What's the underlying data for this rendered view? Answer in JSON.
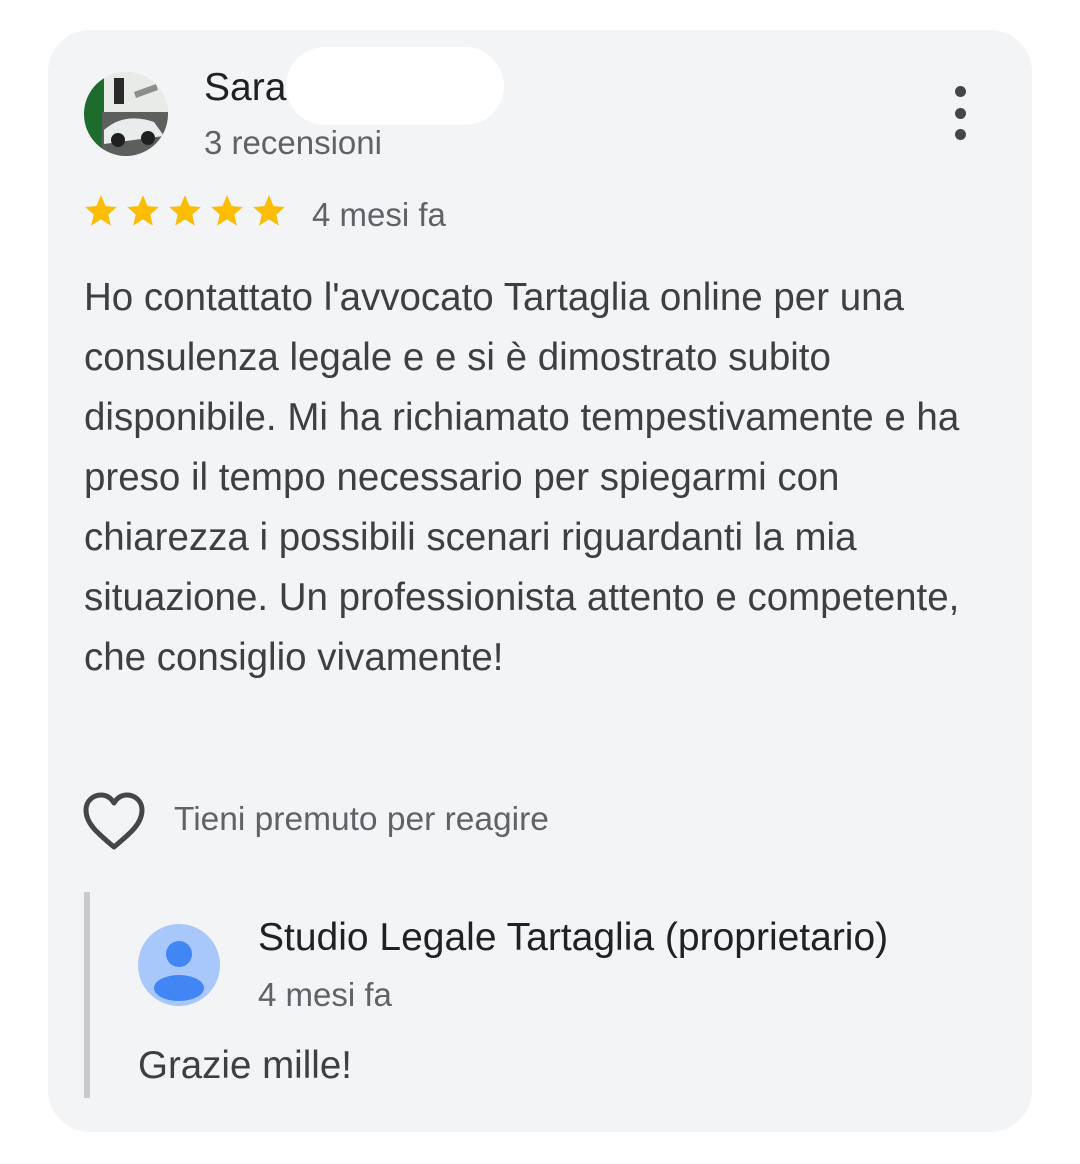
{
  "review": {
    "reviewer": {
      "name": "Sara",
      "review_count": "3 recensioni"
    },
    "rating": 5,
    "max_rating": 5,
    "time": "4 mesi fa",
    "text": "Ho contattato l'avvocato Tartaglia online per una consulenza legale e e si è dimostrato subito disponibile. Mi ha richiamato tempestivamente e ha preso il tempo necessario per spiegarmi con chiarezza i possibili scenari riguardanti la mia situazione. Un professionista attento e competente, che consiglio vivamente!",
    "react_hint": "Tieni premuto per reagire"
  },
  "reply": {
    "owner_name": "Studio Legale Tartaglia (proprietario)",
    "time": "4 mesi fa",
    "text": "Grazie mille!"
  },
  "icons": {
    "menu": "more-vert-icon",
    "star": "star-icon",
    "reaction": "heart-outline-icon",
    "owner_avatar": "person-icon"
  },
  "colors": {
    "star": "#fbbc04",
    "card_background": "#f3f4f6",
    "owner_avatar_bg": "#a8c7fa",
    "owner_avatar_fg": "#4285f4"
  }
}
